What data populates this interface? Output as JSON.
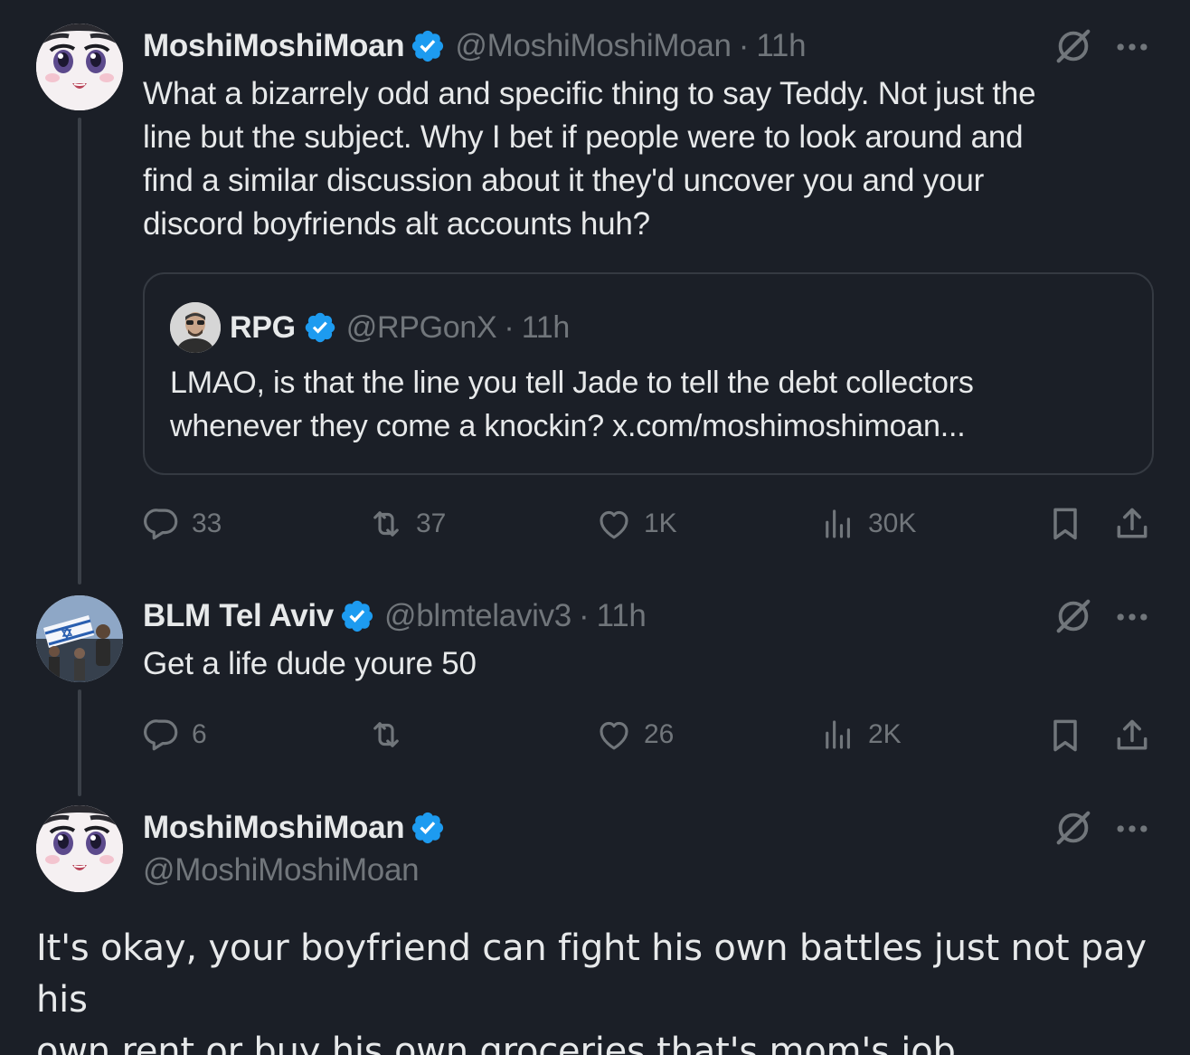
{
  "tweet1": {
    "display_name": "MoshiMoshiMoan",
    "handle": "@MoshiMoshiMoan",
    "separator": "·",
    "time": "11h",
    "text_lines": [
      "What a bizarrely odd and specific thing to say Teddy.  Not just the",
      "line but the subject.  Why I bet if people were to look around and",
      "find a similar discussion about it they'd uncover you and your",
      "discord boyfriends alt accounts huh?"
    ],
    "quote": {
      "display_name": "RPG",
      "handle": "@RPGonX",
      "separator": "·",
      "time": "11h",
      "text_lines": [
        "LMAO, is that the line you tell Jade to tell the debt collectors",
        "whenever they come a knockin? x.com/moshimoshimoan..."
      ]
    },
    "actions": {
      "replies": "33",
      "reposts": "37",
      "likes": "1K",
      "views": "30K"
    }
  },
  "tweet2": {
    "display_name": "BLM Tel Aviv",
    "handle": "@blmtelaviv3",
    "separator": "·",
    "time": "11h",
    "text": "Get a life dude youre 50",
    "actions": {
      "replies": "6",
      "reposts": "",
      "likes": "26",
      "views": "2K"
    }
  },
  "tweet3": {
    "display_name": "MoshiMoshiMoan",
    "handle": "@MoshiMoshiMoan",
    "text_lines": [
      "It's okay, your boyfriend can fight his own battles just not pay his",
      "own rent or buy his own groceries that's mom's job."
    ]
  },
  "icons": [
    "verified-badge-icon",
    "grok-icon",
    "more-icon",
    "reply-icon",
    "repost-icon",
    "like-icon",
    "views-icon",
    "bookmark-icon",
    "share-icon"
  ],
  "colors": {
    "background": "#1b1f27",
    "text": "#e7e9ea",
    "muted": "#71767b",
    "verified": "#1d9bf0",
    "border": "#353a42"
  }
}
